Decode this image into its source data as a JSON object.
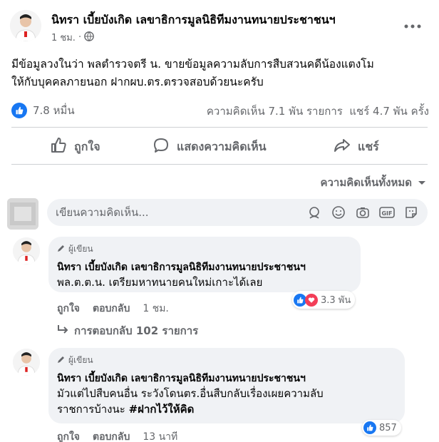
{
  "post": {
    "author": "นิทรา เบี้ยบังเกิด เลขาธิการมูลนิธิทีมงานทนายประชาชนฯ",
    "time": "1 ชม.",
    "separator": "·",
    "text_line1": "มีข้อมูลวงในว่า พลตำรวจตรี น. ขายข้อมูลความลับการสืบสวนคดีน้องแตงโม",
    "text_line2": "ให้กับบุคคลภายนอก ฝากผบ.ตร.ตรวจสอบด้วยนะครับ",
    "reaction_count": "7.8 หมื่น",
    "stats": "ความคิดเห็น 7.1 พัน รายการ  แชร์ 4.7 พัน ครั้ง"
  },
  "actions": {
    "like": "ถูกใจ",
    "comment": "แสดงความคิดเห็น",
    "share": "แชร์"
  },
  "sort": {
    "label": "ความคิดเห็นทั้งหมด"
  },
  "composer": {
    "placeholder": "เขียนความคิดเห็น..."
  },
  "comments": [
    {
      "badge": "ผู้เขียน",
      "author": "นิทรา เบี้ยบังเกิด เลขาธิการมูลนิธิทีมงานทนายประชาชนฯ",
      "text_line1": "พล.ต.ต.น. เตรียมหาทนายคนใหม่เกาะได้เลย",
      "like": "ถูกใจ",
      "reply": "ตอบกลับ",
      "time": "1 ชม.",
      "reaction_count": "3.3 พัน",
      "replies": "การตอบกลับ 102 รายการ"
    },
    {
      "badge": "ผู้เขียน",
      "author": "นิทรา เบี้ยบังเกิด เลขาธิการมูลนิธิทีมงานทนายประชาชนฯ",
      "text_line1": "มัวแต่ไปสืบคนอื่น ระวังโดนตร.อื่นสืบกลับเรื่องเผยความลับ",
      "text_line2": "ราชการบ้างนะ",
      "hashtag": "#ฝากไว้ให้คิด",
      "like": "ถูกใจ",
      "reply": "ตอบกลับ",
      "time": "13 นาที",
      "reaction_count": "857"
    }
  ],
  "colors": {
    "accent": "#1877f2",
    "love": "#f33e58",
    "muted": "#65676b",
    "bubble": "#f0f2f5",
    "divider": "#ced0d4"
  },
  "icons": [
    "globe-icon",
    "more-icon",
    "like-icon",
    "comment-icon",
    "share-icon",
    "chevron-down-icon",
    "emoji-icon",
    "camera-icon",
    "gif-icon",
    "sticker-icon",
    "pencil-icon",
    "reply-arrow-icon",
    "love-icon"
  ]
}
